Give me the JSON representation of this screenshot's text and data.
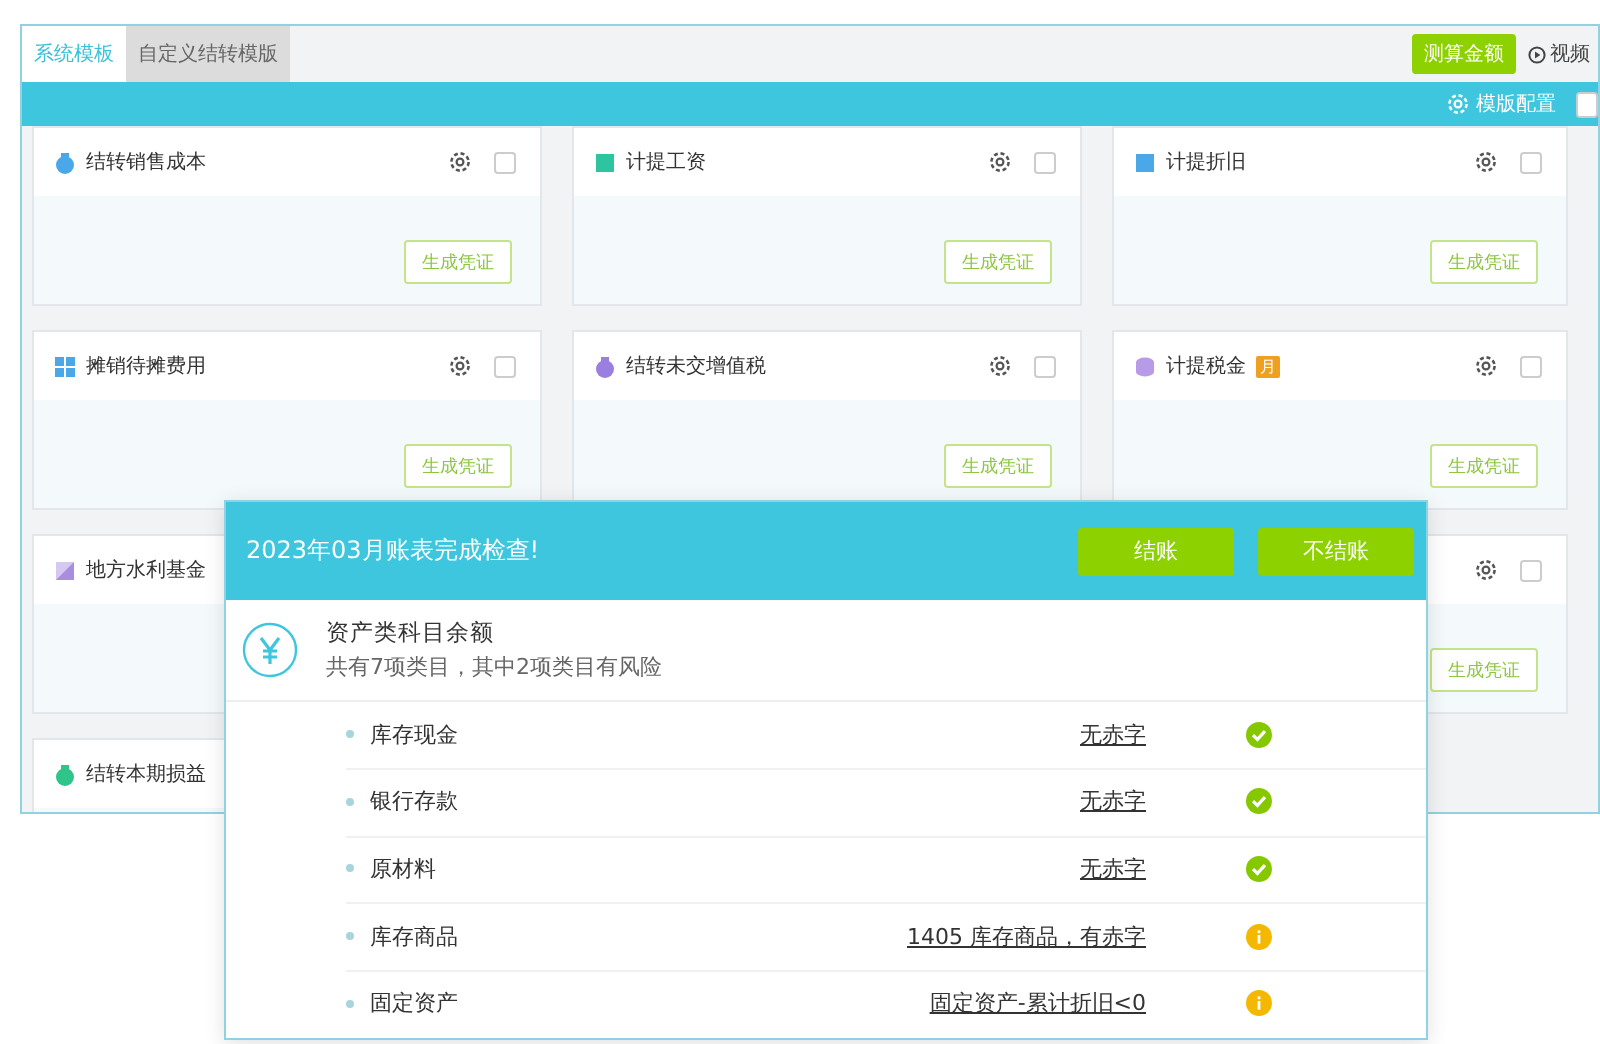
{
  "tabs": [
    {
      "label": "系统模板",
      "selected": true
    },
    {
      "label": "自定义结转模版",
      "selected": false
    }
  ],
  "toolbar": {
    "calc_button": "测算金额",
    "video_link": "视频"
  },
  "config_bar": {
    "config_link": "模版配置",
    "select_all_checked": false
  },
  "cards": [
    {
      "title": "结转销售成本",
      "kind": "bag",
      "color": "#4aa8e8",
      "checked": false,
      "button": "生成凭证"
    },
    {
      "title": "计提工资",
      "kind": "square",
      "color": "#2ec4a0",
      "checked": false,
      "button": "生成凭证"
    },
    {
      "title": "计提折旧",
      "kind": "square",
      "color": "#4aa8e8",
      "checked": false,
      "button": "生成凭证"
    },
    {
      "title": "摊销待摊费用",
      "kind": "grid",
      "color": "#4aa8e8",
      "checked": false,
      "button": "生成凭证"
    },
    {
      "title": "结转未交增值税",
      "kind": "bag",
      "color": "#9b7fe0",
      "checked": false,
      "button": "生成凭证"
    },
    {
      "title": "计提税金",
      "kind": "coins",
      "color": "#b89be8",
      "badge": "月",
      "checked": false,
      "button": "生成凭证"
    },
    {
      "title": "地方水利基金",
      "kind": "half",
      "color": "#a98ee0"
    },
    {
      "checked": false,
      "button": "生成凭证"
    },
    {
      "title": "结转本期损益",
      "kind": "bag",
      "color": "#2ec48a"
    }
  ],
  "dialog": {
    "title": "2023年03月账表完成检查!",
    "buttons": [
      "结账",
      "不结账"
    ],
    "section": {
      "title": "资产类科目余额",
      "subtitle": "共有7项类目，其中2项类目有风险"
    },
    "rows": [
      {
        "name": "库存现金",
        "result": "无赤字",
        "kind": "ok"
      },
      {
        "name": "银行存款",
        "result": "无赤字",
        "kind": "ok"
      },
      {
        "name": "原材料",
        "result": "无赤字",
        "kind": "ok"
      },
      {
        "name": "库存商品",
        "result": "1405 库存商品，有赤字",
        "kind": "warn"
      },
      {
        "name": "固定资产",
        "result": "固定资产-累计折旧<0",
        "kind": "warn"
      }
    ]
  }
}
